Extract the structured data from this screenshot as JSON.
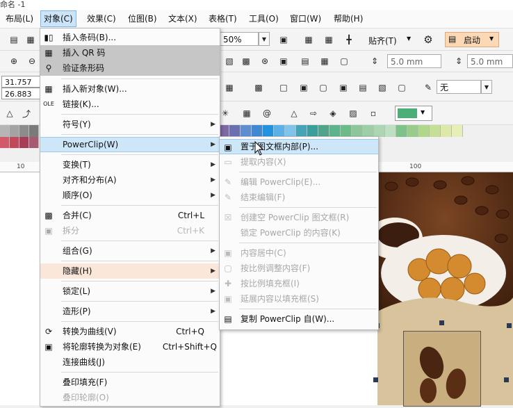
{
  "window": {
    "title": "命名 -1"
  },
  "menubar": [
    {
      "label": "布局(L)"
    },
    {
      "label": "对象(C)"
    },
    {
      "label": "效果(C)"
    },
    {
      "label": "位图(B)"
    },
    {
      "label": "文本(X)"
    },
    {
      "label": "表格(T)"
    },
    {
      "label": "工具(O)"
    },
    {
      "label": "窗口(W)"
    },
    {
      "label": "帮助(H)"
    }
  ],
  "toolbar": {
    "zoom": "50%",
    "snap_label": "贴齐(T)",
    "launch_label": "启动",
    "nudge1": "5.0 mm",
    "nudge2": "5.0 mm",
    "outline": "无",
    "x_value": "31.757 mm",
    "y_value": "26.883 mm",
    "fill_color": "#4caf7a"
  },
  "ruler": {
    "mark_10": "10",
    "mark_100": "100"
  },
  "object_menu": {
    "items": [
      {
        "label": "插入条码(B)...",
        "icon": "barcode-icon"
      },
      {
        "label": "插入 QR 码",
        "icon": "qr-code-icon"
      },
      {
        "label": "验证条形码",
        "icon": "verify-barcode-icon"
      },
      {
        "label": "插入新对象(W)...",
        "icon": "insert-object-icon"
      },
      {
        "label": "链接(K)...",
        "icon": "ole-link-icon"
      },
      {
        "label": "符号(Y)"
      },
      {
        "label": "PowerClip(W)"
      },
      {
        "label": "变换(T)"
      },
      {
        "label": "对齐和分布(A)"
      },
      {
        "label": "顺序(O)"
      },
      {
        "label": "合并(C)",
        "shortcut": "Ctrl+L",
        "icon": "combine-icon"
      },
      {
        "label": "拆分",
        "shortcut": "Ctrl+K",
        "icon": "break-apart-icon"
      },
      {
        "label": "组合(G)"
      },
      {
        "label": "隐藏(H)"
      },
      {
        "label": "锁定(L)"
      },
      {
        "label": "造形(P)"
      },
      {
        "label": "转换为曲线(V)",
        "shortcut": "Ctrl+Q",
        "icon": "convert-curves-icon"
      },
      {
        "label": "将轮廓转换为对象(E)",
        "shortcut": "Ctrl+Shift+Q",
        "icon": "outline-to-object-icon"
      },
      {
        "label": "连接曲线(J)"
      },
      {
        "label": "叠印填充(F)"
      },
      {
        "label": "叠印轮廓(O)"
      }
    ]
  },
  "powerclip_submenu": {
    "items": [
      {
        "label": "置于图文框内部(P)...",
        "icon": "place-inside-frame-icon"
      },
      {
        "label": "提取内容(X)",
        "icon": "extract-contents-icon"
      },
      {
        "label": "编辑 PowerClip(E)...",
        "icon": "edit-powerclip-icon"
      },
      {
        "label": "结束编辑(F)",
        "icon": "finish-editing-icon"
      },
      {
        "label": "创建空 PowerClip 图文框(R)",
        "icon": "create-empty-frame-icon"
      },
      {
        "label": "锁定 PowerClip 的内容(K)"
      },
      {
        "label": "内容居中(C)",
        "icon": "center-content-icon"
      },
      {
        "label": "按比例调整内容(F)",
        "icon": "fit-content-icon"
      },
      {
        "label": "按比例填充框(I)",
        "icon": "fill-frame-icon"
      },
      {
        "label": "延展内容以填充框(S)",
        "icon": "stretch-content-icon"
      },
      {
        "label": "复制 PowerClip 自(W)...",
        "icon": "copy-powerclip-icon"
      }
    ]
  }
}
